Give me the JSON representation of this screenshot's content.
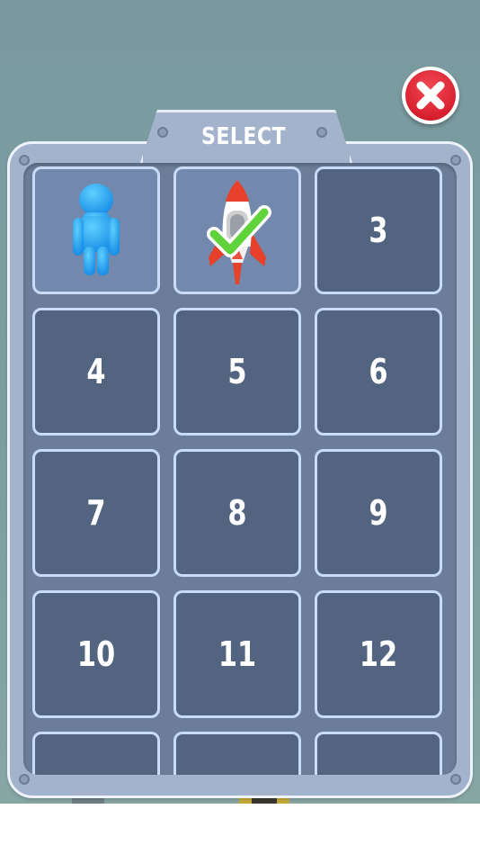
{
  "screen": {
    "title": "SELECT",
    "close_icon": "close-x-icon"
  },
  "colors": {
    "background": "#7a9aa0",
    "panel": "#a4b3cc",
    "grid_window": "#6b7d98",
    "locked_slot": "#52647f",
    "unlocked_slot": "#7288ad",
    "slot_border": "#c9dcf7",
    "close_button": "#d8202f"
  },
  "slots": [
    {
      "label": "",
      "state": "unlocked",
      "icon": "blue-stickman-icon",
      "selected": false
    },
    {
      "label": "",
      "state": "unlocked",
      "icon": "rocket-icon",
      "selected": true,
      "badge_icon": "checkmark-icon"
    },
    {
      "label": "3",
      "state": "locked"
    },
    {
      "label": "4",
      "state": "locked"
    },
    {
      "label": "5",
      "state": "locked"
    },
    {
      "label": "6",
      "state": "locked"
    },
    {
      "label": "7",
      "state": "locked"
    },
    {
      "label": "8",
      "state": "locked"
    },
    {
      "label": "9",
      "state": "locked"
    },
    {
      "label": "10",
      "state": "locked"
    },
    {
      "label": "11",
      "state": "locked"
    },
    {
      "label": "12",
      "state": "locked"
    },
    {
      "label": "",
      "state": "locked"
    },
    {
      "label": "",
      "state": "locked"
    },
    {
      "label": "",
      "state": "locked"
    }
  ]
}
